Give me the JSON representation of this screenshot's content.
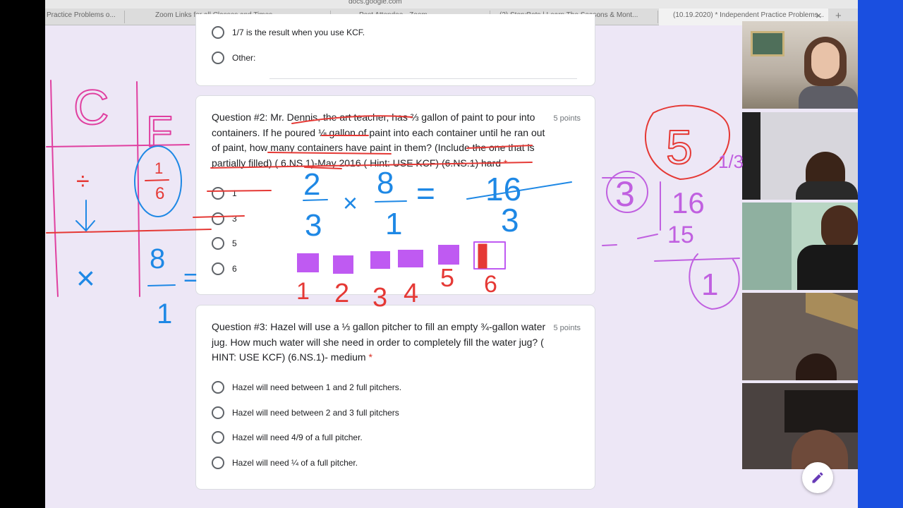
{
  "browser": {
    "url": "docs.google.com",
    "tabs": [
      "Practice Problems o...",
      "Zoom Links for all Classes and Times",
      "Post Attendee - Zoom",
      "(2) StoryBots | Learn The Seasons & Mont...",
      "(10.19.2020) * Independent Practice Problems..."
    ],
    "close_label": "×",
    "new_tab_label": "+"
  },
  "form": {
    "prev_options": [
      "1/7 is the result when you use KCF.",
      "Other:"
    ],
    "q2": {
      "text": "Question #2: Mr. Dennis, the art teacher, has ⅔ gallon of paint to pour into containers. If he poured ⅛ gallon of paint into each container until he ran out of paint, how many containers have paint in them? (Include the one that is partially filled) ( 6.NS.1)-May 2016 ( Hint: USE KCF) (6.NS.1) hard",
      "required": "*",
      "points": "5 points",
      "options": [
        "1",
        "3",
        "5",
        "6"
      ]
    },
    "q3": {
      "text": "Question #3: Hazel will use a ⅓ gallon pitcher to fill an empty ¾-gallon water jug. How much water will she need in order to completely fill the water jug? ( HINT: USE KCF) (6.NS.1)- medium",
      "required": "*",
      "points": "5 points",
      "options": [
        "Hazel will need between 1 and 2 full pitchers.",
        "Hazel will need between 2 and 3 full pitchers",
        "Hazel will need 4/9 of a full pitcher.",
        "Hazel will need ¼ of a full pitcher."
      ]
    }
  },
  "annotations": {
    "kcf_headers": [
      "C",
      "F"
    ],
    "division_symbol": "÷",
    "circled_fraction": [
      "1",
      "6"
    ],
    "times_symbol": "×",
    "reciprocal": [
      "8",
      "1"
    ],
    "equals": "=",
    "equation": [
      "2",
      "3",
      "×",
      "8",
      "1",
      "=",
      "16",
      "3"
    ],
    "box_counts": [
      "1",
      "2",
      "3",
      "4",
      "5",
      "6"
    ],
    "right_work": [
      "3",
      "16",
      "5",
      "15",
      "1",
      "1/3"
    ],
    "colors": {
      "pink": "#e040a0",
      "blue": "#1e88e5",
      "red": "#e53935",
      "purple": "#c060e0",
      "box_fill": "#bf5af2"
    }
  },
  "video_panel": {
    "tiles": [
      "participant-1",
      "participant-2",
      "participant-3",
      "participant-4",
      "participant-5"
    ]
  },
  "edit_icon": "pencil-icon"
}
